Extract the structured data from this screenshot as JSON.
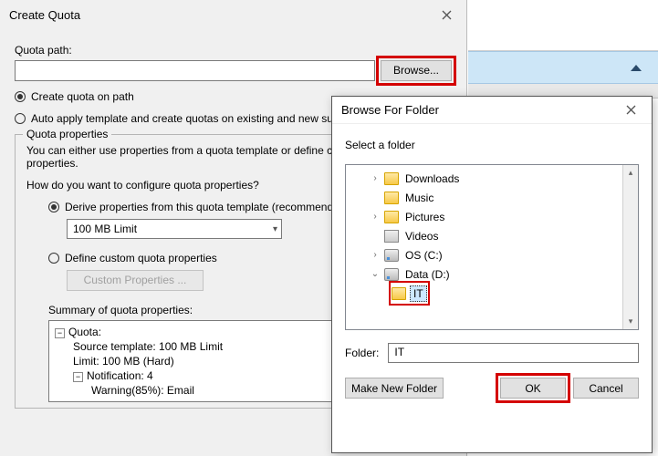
{
  "create_quota": {
    "title": "Create Quota",
    "quota_path_label": "Quota path:",
    "quota_path_value": "",
    "browse_label": "Browse...",
    "opt_create_on_path": "Create quota on path",
    "opt_auto_apply": "Auto apply template and create quotas on existing and new subfolders",
    "group_title": "Quota properties",
    "intro_text": "You can either use properties from a quota template or define custom quota properties.",
    "configure_q": "How do you want to configure quota properties?",
    "opt_derive": "Derive properties from this quota template (recommended):",
    "template_selected": "100 MB Limit",
    "opt_custom": "Define custom quota properties",
    "custom_btn": "Custom Properties ...",
    "summary_label": "Summary of quota properties:",
    "summary_tree": {
      "root": "Quota:",
      "line1": "Source template: 100 MB Limit",
      "line2": "Limit: 100 MB (Hard)",
      "notif": "Notification: 4",
      "notif_child": "Warning(85%): Email"
    }
  },
  "browse": {
    "title": "Browse For Folder",
    "instruction": "Select a folder",
    "tree": {
      "downloads": "Downloads",
      "music": "Music",
      "pictures": "Pictures",
      "videos": "Videos",
      "osc": "OS (C:)",
      "datad": "Data (D:)",
      "it": "IT"
    },
    "folder_label": "Folder:",
    "folder_value": "IT",
    "make_new": "Make New Folder",
    "ok": "OK",
    "cancel": "Cancel"
  }
}
